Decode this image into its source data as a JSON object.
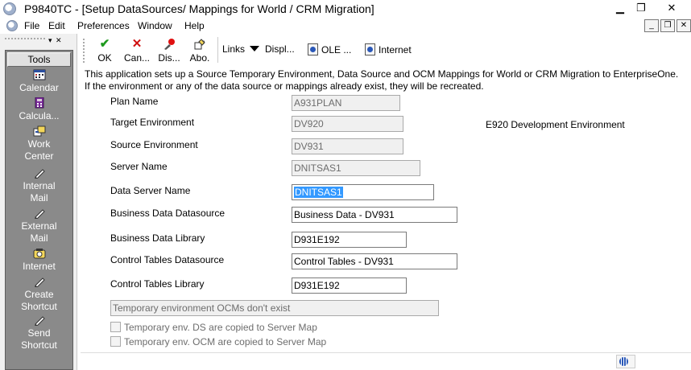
{
  "window": {
    "title": "P9840TC - [Setup DataSources/ Mappings for World / CRM Migration]",
    "minimize": "▁",
    "restore": "❐",
    "close": "✕"
  },
  "menubar": {
    "items": [
      "File",
      "Edit",
      "Preferences",
      "Window",
      "Help"
    ],
    "mdi_minimize": "_",
    "mdi_restore": "❐",
    "mdi_close": "✕"
  },
  "left_pane": {
    "controls": "▾ ✕",
    "tools_header": "Tools",
    "tools": [
      {
        "line1": "Calendar",
        "line2": "",
        "icon": "calendar-icon"
      },
      {
        "line1": "Calcula...",
        "line2": "",
        "icon": "calculator-icon"
      },
      {
        "line1": "Work",
        "line2": "Center",
        "icon": "work-center-icon"
      },
      {
        "line1": "Internal",
        "line2": "Mail",
        "icon": "internal-mail-icon"
      },
      {
        "line1": "External",
        "line2": "Mail",
        "icon": "external-mail-icon"
      },
      {
        "line1": "Internet",
        "line2": "",
        "icon": "internet-icon"
      },
      {
        "line1": "Create",
        "line2": "Shortcut",
        "icon": "create-shortcut-icon"
      },
      {
        "line1": "Send",
        "line2": "Shortcut",
        "icon": "send-shortcut-icon"
      }
    ]
  },
  "toolbar": {
    "ok": "OK",
    "cancel": "Can...",
    "display_errors": "Dis...",
    "about": "Abo.",
    "links": "Links",
    "display": "Displ...",
    "ole": "OLE ...",
    "internet": "Internet"
  },
  "form": {
    "instructions_line1": "This application sets up a Source Temporary Environment, Data Source and OCM Mappings for World or CRM Migration to EnterpriseOne.",
    "instructions_line2": "If the environment or any of the data source or mappings already exist, they will be recreated.",
    "plan_name_label": "Plan Name",
    "plan_name_value": "A931PLAN",
    "target_env_label": "Target Environment",
    "target_env_value": "DV920",
    "target_env_description": "E920 Development Environment",
    "source_env_label": "Source Environment",
    "source_env_value": "DV931",
    "server_name_label": "Server Name",
    "server_name_value": "DNITSAS1",
    "data_server_label": "Data Server Name",
    "data_server_value": "DNITSAS1",
    "bus_data_ds_label": "Business Data Datasource",
    "bus_data_ds_value": "Business Data - DV931",
    "bus_data_lib_label": "Business Data Library",
    "bus_data_lib_value": "D931E192",
    "ctrl_tables_ds_label": "Control Tables Datasource",
    "ctrl_tables_ds_value": "Control Tables - DV931",
    "ctrl_tables_lib_label": "Control Tables Library",
    "ctrl_tables_lib_value": "D931E192",
    "temp_env_status": "Temporary environment OCMs don't exist",
    "chk_ds_copied": "Temporary env. DS are copied to Server Map",
    "chk_ocm_copied": "Temporary env. OCM are copied to Server Map"
  }
}
